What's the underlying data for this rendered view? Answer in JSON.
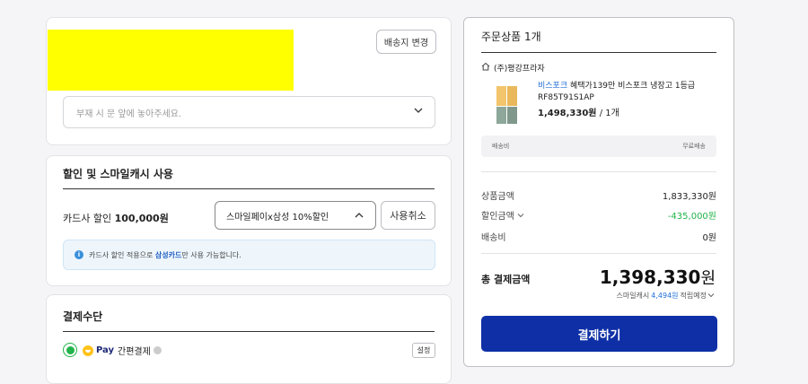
{
  "shipping": {
    "change_button": "배송지 변경",
    "request_placeholder": "부재 시 문 앞에 놓아주세요."
  },
  "discount": {
    "title": "할인 및 스마일캐시 사용",
    "card_label_prefix": "카드사 할인",
    "card_amount": "100,000원",
    "selected_option": "스마일페이x삼성 10%할인",
    "cancel_button": "사용취소",
    "info_prefix": "카드사 할인 적용으로",
    "info_highlight": "삼성카드",
    "info_suffix": "만 사용 가능합니다."
  },
  "payment": {
    "title": "결제수단",
    "pay_logo_text": "Pay",
    "method_name": "간편결제",
    "settings_button": "설정"
  },
  "summary": {
    "title": "주문상품 1개",
    "seller": "(주)평강프라자",
    "brand": "비스포크",
    "product_name": "혜택가139만 비스포크 냉장고 1등급 RF85T91S1AP",
    "price": "1,498,330원",
    "qty": "/ 1개",
    "ship_label": "배송비",
    "ship_value": "무료배송",
    "product_amount_label": "상품금액",
    "product_amount": "1,833,330원",
    "discount_label": "할인금액",
    "discount_amount": "-435,000원",
    "ship_fee_label": "배송비",
    "ship_fee": "0원",
    "total_label": "총 결제금액",
    "total_number": "1,398,330",
    "total_unit": "원",
    "cash_prefix": "스마일캐시",
    "cash_amount": "4,494원",
    "cash_suffix": "적립예정",
    "checkout_button": "결제하기"
  },
  "colors": {
    "accent_blue": "#0e2fa6",
    "discount_green": "#22b34a",
    "link_blue": "#1f6fd6",
    "redaction_yellow": "#ffff00"
  }
}
